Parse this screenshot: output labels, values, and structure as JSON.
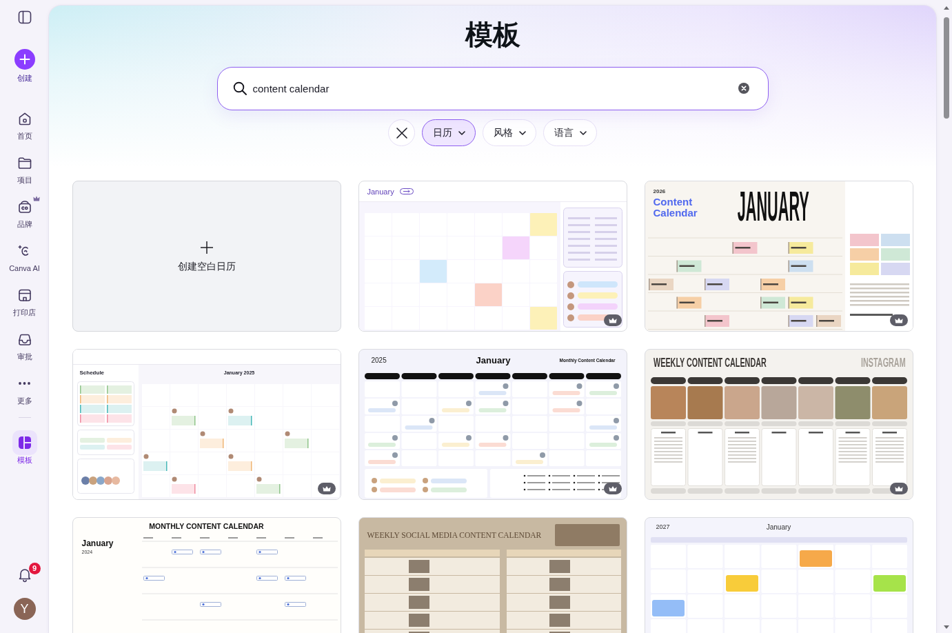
{
  "sidebar": {
    "create": {
      "label": "创建"
    },
    "items": [
      {
        "label": "首页",
        "selected": false,
        "premium": false
      },
      {
        "label": "项目",
        "selected": false,
        "premium": false
      },
      {
        "label": "品牌",
        "selected": false,
        "premium": true
      },
      {
        "label": "Canva AI",
        "selected": false,
        "premium": false
      },
      {
        "label": "打印店",
        "selected": false,
        "premium": false
      },
      {
        "label": "审批",
        "selected": false,
        "premium": false
      },
      {
        "label": "更多",
        "selected": false,
        "premium": false
      }
    ],
    "pinned": [
      {
        "label": "模板",
        "selected": true,
        "premium": false
      }
    ],
    "notifications": {
      "count": "9"
    },
    "account": {
      "initial": "Y"
    }
  },
  "page": {
    "title": "模板"
  },
  "search": {
    "value": "content calendar"
  },
  "filters": [
    {
      "label": "日历",
      "selected": true
    },
    {
      "label": "风格",
      "selected": false
    },
    {
      "label": "语言",
      "selected": false
    }
  ],
  "templates": [
    {
      "kind": "blank",
      "label": "创建空白日历",
      "premium": false
    },
    {
      "kind": "month-lavender",
      "texts": [
        "January"
      ],
      "premium": true
    },
    {
      "kind": "month-cream",
      "texts": [
        "2026",
        "Content Calendar",
        "JANUARY"
      ],
      "premium": true
    },
    {
      "kind": "schedule",
      "texts": [
        "Schedule",
        "January 2025"
      ],
      "premium": true
    },
    {
      "kind": "month-bold",
      "texts": [
        "2025",
        "January",
        "Monthly Content Calendar"
      ],
      "premium": true
    },
    {
      "kind": "week-photos",
      "texts": [
        "WEEKLY CONTENT CALENDAR",
        "INSTAGRAM"
      ],
      "premium": true
    },
    {
      "kind": "month-plain",
      "texts": [
        "MONTHLY CONTENT CALENDAR",
        "January",
        "2024"
      ],
      "premium": false
    },
    {
      "kind": "week-table",
      "texts": [
        "WEEKLY SOCIAL MEDIA CONTENT CALENDAR"
      ],
      "premium": false
    },
    {
      "kind": "month-pastel",
      "texts": [
        "2027",
        "January"
      ],
      "premium": false
    }
  ]
}
